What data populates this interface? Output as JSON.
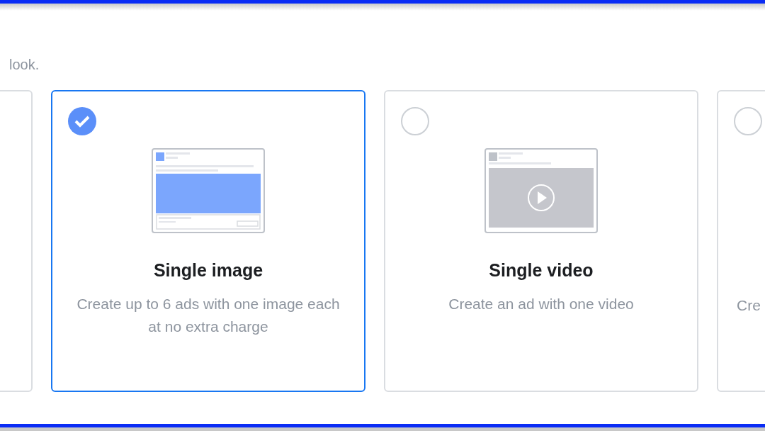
{
  "intro_text": "look.",
  "cards": [
    {
      "kind": "blank",
      "selected": false
    },
    {
      "kind": "image",
      "selected": true,
      "title": "Single image",
      "description": "Create up to 6 ads with one image each at no extra charge"
    },
    {
      "kind": "video",
      "selected": false,
      "title": "Single video",
      "description": "Create an ad with one video"
    },
    {
      "kind": "cut",
      "selected": false,
      "description": "Cre"
    }
  ]
}
